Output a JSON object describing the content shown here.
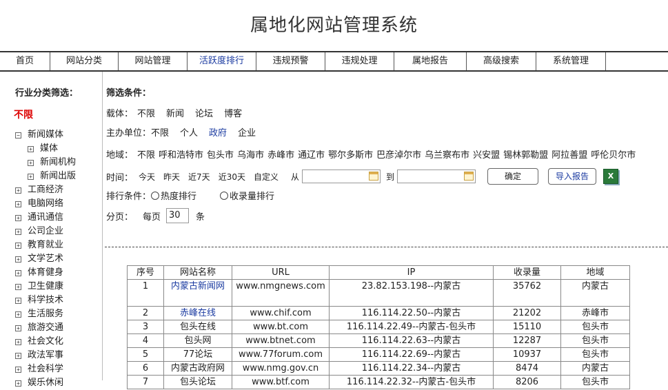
{
  "app_title": "属地化网站管理系统",
  "nav": [
    "首页",
    "网站分类",
    "网站管理",
    "活跃度排行",
    "违规预警",
    "违规处理",
    "属地报告",
    "高级搜索",
    "系统管理"
  ],
  "nav_active": "活跃度排行",
  "sidebar": {
    "title": "行业分类筛选：",
    "any": "不限",
    "items": [
      {
        "label": "新闻媒体",
        "expanded": true
      },
      {
        "label": "媒体",
        "sub": true
      },
      {
        "label": "新闻机构",
        "sub": true
      },
      {
        "label": "新闻出版",
        "sub": true
      },
      {
        "label": "工商经济"
      },
      {
        "label": "电脑网络"
      },
      {
        "label": "通讯通信"
      },
      {
        "label": "公司企业"
      },
      {
        "label": "教育就业"
      },
      {
        "label": "文学艺术"
      },
      {
        "label": "体育健身"
      },
      {
        "label": "卫生健康"
      },
      {
        "label": "科学技术"
      },
      {
        "label": "生活服务"
      },
      {
        "label": "旅游交通"
      },
      {
        "label": "社会文化"
      },
      {
        "label": "政法军事"
      },
      {
        "label": "社会科学"
      },
      {
        "label": "娱乐休闲"
      }
    ]
  },
  "filters": {
    "heading": "筛选条件：",
    "carrier_label": "载体：",
    "carrier_options": [
      "不限",
      "新闻",
      "论坛",
      "博客"
    ],
    "sponsor_label": "主办单位：",
    "sponsor_options": [
      "不限",
      "个人",
      "政府",
      "企业"
    ],
    "sponsor_selected": "政府",
    "region_label": "地域：",
    "region_options": [
      "不限",
      "呼和浩特市",
      "包头市",
      "乌海市",
      "赤峰市",
      "通辽市",
      "鄂尔多斯市",
      "巴彦淖尔市",
      "乌兰察布市",
      "兴安盟",
      "锡林郭勒盟",
      "阿拉善盟",
      "呼伦贝尔市"
    ],
    "time_label": "时间：",
    "time_options": [
      "今天",
      "昨天",
      "近7天",
      "近30天",
      "自定义"
    ],
    "from_label": "从",
    "to_label": "到",
    "confirm_label": "确定",
    "import_label": "导入报告",
    "excel_label": "X",
    "sort_label": "排行条件：",
    "sort_heat": "热度排行",
    "sort_count": "收录量排行",
    "page_label": "分页：",
    "per_page_label": "每页",
    "per_page_value": "30",
    "per_page_unit": "条"
  },
  "table": {
    "headers": [
      "序号",
      "网站名称",
      "URL",
      "IP",
      "收录量",
      "地域"
    ],
    "rows": [
      {
        "no": "1",
        "name": "内蒙古新闻网",
        "url": "www.nmgnews.com",
        "ip": "23.82.153.198--内蒙古",
        "count": "35762",
        "region": "内蒙古",
        "link": true,
        "tall": true
      },
      {
        "no": "2",
        "name": "赤峰在线",
        "url": "www.chif.com",
        "ip": "116.114.22.50--内蒙古",
        "count": "21202",
        "region": "赤峰市",
        "link": true
      },
      {
        "no": "3",
        "name": "包头在线",
        "url": "www.bt.com",
        "ip": "116.114.22.49--内蒙古-包头市",
        "count": "15110",
        "region": "包头市"
      },
      {
        "no": "4",
        "name": "包头网",
        "url": "www.btnet.com",
        "ip": "116.114.22.63--内蒙古",
        "count": "12287",
        "region": "包头市"
      },
      {
        "no": "5",
        "name": "77论坛",
        "url": "www.77forum.com",
        "ip": "116.114.22.69--内蒙古",
        "count": "10937",
        "region": "包头市"
      },
      {
        "no": "6",
        "name": "内蒙古政府网",
        "url": "www.nmg.gov.cn",
        "ip": "116.114.22.34--内蒙古",
        "count": "8474",
        "region": "内蒙古"
      },
      {
        "no": "7",
        "name": "包头论坛",
        "url": "www.btf.com",
        "ip": "116.114.22.32--内蒙古-包头市",
        "count": "8206",
        "region": "包头市"
      }
    ]
  }
}
